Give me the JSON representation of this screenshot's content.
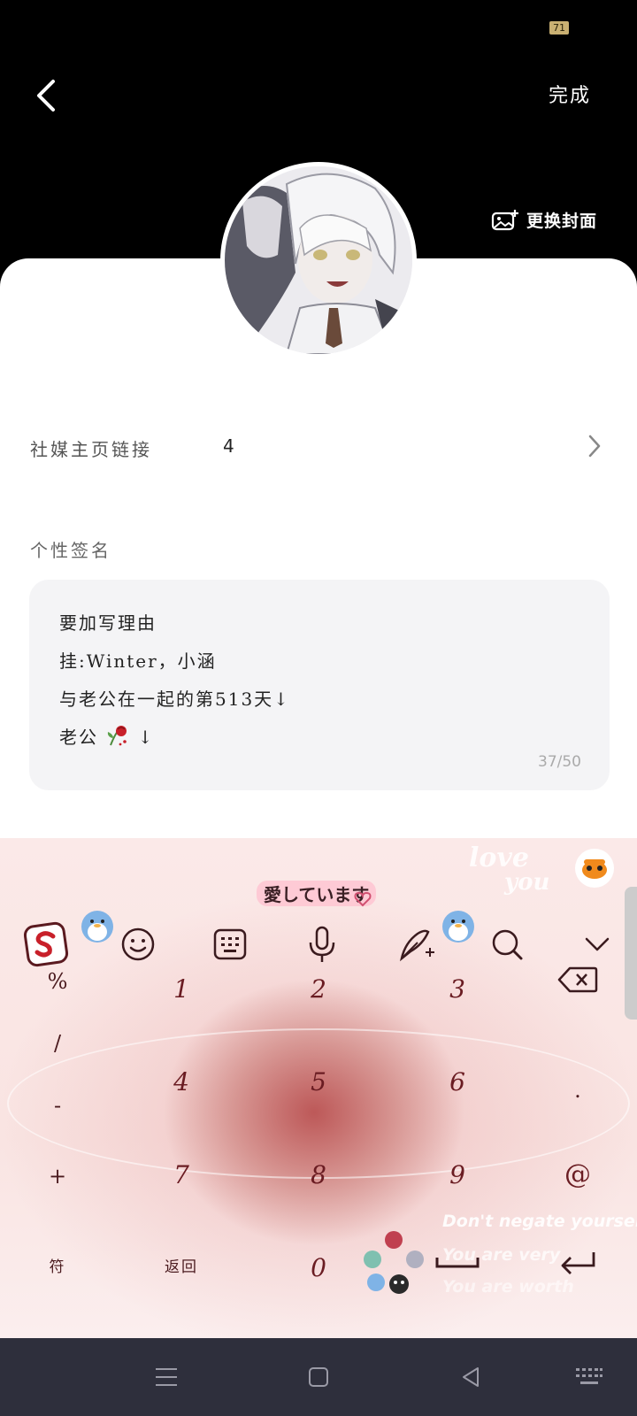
{
  "status_bar": {
    "battery": "71"
  },
  "header": {
    "done_label": "完成",
    "change_cover_label": "更换封面"
  },
  "profile": {
    "social_label": "社媒主页链接",
    "social_value": "4",
    "signature_label": "个性签名",
    "signature_lines": [
      "要加写理由",
      "挂:Winter，小涵",
      "与老公在一起的第513天↓",
      "老公"
    ],
    "signature_line4_suffix": "↓",
    "signature_count": "37/50"
  },
  "keyboard": {
    "decor": {
      "love": "love",
      "you": "you",
      "jp": "愛しています",
      "en1": "Don't negate yourself",
      "en2": "You are very",
      "en3": "You are worth"
    },
    "keys": {
      "pct": "%",
      "slash": "/",
      "dash": "-",
      "plus": "+",
      "fu": "符",
      "k1": "1",
      "k2": "2",
      "k3": "3",
      "k4": "4",
      "k5": "5",
      "k6": "6",
      "k7": "7",
      "k8": "8",
      "k9": "9",
      "back": "返回",
      "k0": "0",
      "dot": ".",
      "at": "@"
    },
    "icons": [
      "sogou-logo-icon",
      "emoji-icon",
      "keyboard-layout-icon",
      "microphone-icon",
      "handwriting-icon",
      "search-icon",
      "chevron-down-icon",
      "backspace-icon",
      "space-icon",
      "enter-icon"
    ]
  },
  "nav_bar": {
    "icons": [
      "menu-icon",
      "home-icon",
      "back-icon",
      "keyboard-icon"
    ]
  },
  "colors": {
    "key_text": "#6a1c22",
    "card_bg": "#ffffff",
    "signature_bg": "#f4f4f6",
    "nav_bg": "#2e2f3c"
  }
}
